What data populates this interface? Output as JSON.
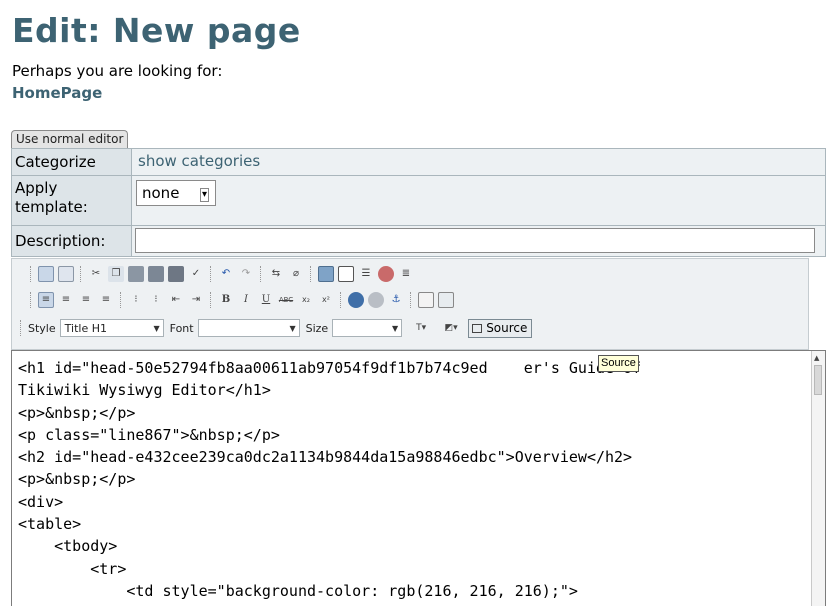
{
  "header": {
    "title": "Edit: New page",
    "subtitle": "Perhaps you are looking for:",
    "suggestion_link": "HomePage"
  },
  "editor_toggle": {
    "label": "Use normal editor"
  },
  "form": {
    "categorize": {
      "label": "Categorize",
      "link": "show categories"
    },
    "template": {
      "label": "Apply template:",
      "selected": "none"
    },
    "description": {
      "label": "Description:",
      "value": ""
    }
  },
  "toolbar": {
    "style_label": "Style",
    "style_value": "Title H1",
    "font_label": "Font",
    "font_value": "",
    "size_label": "Size",
    "size_value": "",
    "source_button": "Source",
    "tooltip": "Source"
  },
  "source_code": [
    "<h1 id=\"head-50e52794fb8aa00611ab97054f9df1b7b74c9ed    er's Guide of",
    "Tikiwiki Wysiwyg Editor</h1>",
    "<p>&nbsp;</p>",
    "<p class=\"line867\">&nbsp;</p>",
    "<h2 id=\"head-e432cee239ca0dc2a1134b9844da15a98846edbc\">Overview</h2>",
    "<p>&nbsp;</p>",
    "<div>",
    "<table>",
    "    <tbody>",
    "        <tr>",
    "            <td style=\"background-color: rgb(216, 216, 216);\">"
  ],
  "colors": {
    "title": "#3d6373",
    "label_bg": "#dde4e8",
    "toolbar_bg": "#eef1f3"
  }
}
